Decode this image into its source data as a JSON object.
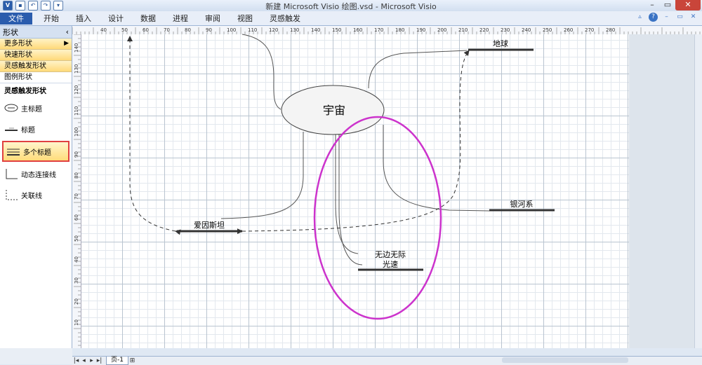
{
  "window": {
    "title": "新建 Microsoft Visio 绘图.vsd - Microsoft Visio",
    "app_icon": "V"
  },
  "ribbon": {
    "tabs": [
      "文件",
      "开始",
      "插入",
      "设计",
      "数据",
      "进程",
      "审阅",
      "视图",
      "灵感触发"
    ]
  },
  "shapes_pane": {
    "title": "形状",
    "items": [
      "更多形状",
      "快速形状",
      "灵感触发形状",
      "图例形状"
    ],
    "stencil_title": "灵感触发形状",
    "stencils": [
      {
        "label": "主标题",
        "icon": "ellipse-icon"
      },
      {
        "label": "标题",
        "icon": "title-line-icon"
      },
      {
        "label": "多个标题",
        "icon": "multi-title-icon"
      },
      {
        "label": "动态连接线",
        "icon": "dynamic-connector-icon"
      },
      {
        "label": "关联线",
        "icon": "relation-line-icon"
      }
    ]
  },
  "ruler_top": [
    "40",
    "50",
    "60",
    "70",
    "80",
    "90",
    "100",
    "110",
    "120",
    "130",
    "140",
    "150",
    "160",
    "170",
    "180",
    "190",
    "200",
    "210",
    "220",
    "230",
    "240",
    "250",
    "260",
    "270",
    "280"
  ],
  "ruler_left": [
    "140",
    "130",
    "120",
    "110",
    "100",
    "90",
    "80",
    "70",
    "60",
    "50",
    "40",
    "30",
    "20",
    "10"
  ],
  "diagram": {
    "main_topic": "宇宙",
    "topics": [
      "地球",
      "银河系",
      "爱因斯坦",
      "无边无际",
      "光速"
    ]
  },
  "page_tab": "页-1",
  "colors": {
    "highlight_ellipse": "#cc33cc",
    "file_tab": "#2a5cad",
    "selection_border": "#e04040"
  }
}
